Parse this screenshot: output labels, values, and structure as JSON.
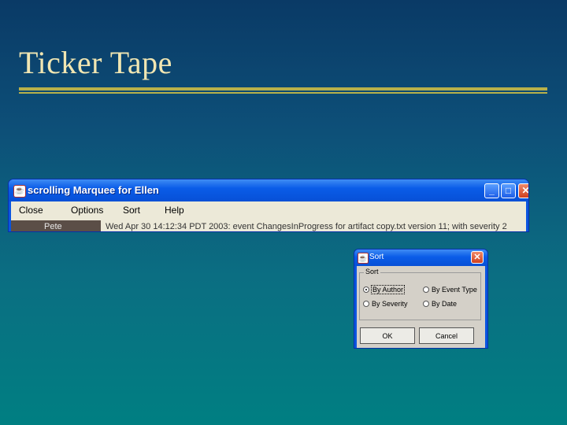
{
  "slide": {
    "title": "Ticker Tape"
  },
  "marquee_window": {
    "title": "scrolling Marquee for Ellen",
    "menu": [
      "Close",
      "Options",
      "Sort",
      "Help"
    ],
    "ticker": {
      "author": "Pete",
      "message": "Wed Apr 30 14:12:34 PDT 2003: event ChangesInProgress for artifact copy.txt version 11; with severity 2"
    },
    "controls": {
      "minimize": "_",
      "maximize": "□",
      "close": "✕"
    }
  },
  "sort_dialog": {
    "title": "Sort",
    "group_label": "Sort",
    "options": [
      {
        "label": "By Author",
        "selected": true
      },
      {
        "label": "By Event Type",
        "selected": false
      },
      {
        "label": "By Severity",
        "selected": false
      },
      {
        "label": "By Date",
        "selected": false
      }
    ],
    "ok_label": "OK",
    "cancel_label": "Cancel",
    "close": "✕"
  },
  "colors": {
    "title_text": "#f1e6b2",
    "rule": "#b8b04a",
    "window_blue": "#0a55e0"
  }
}
